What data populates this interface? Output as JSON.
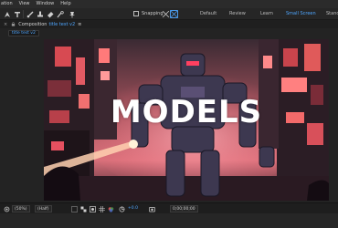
{
  "menu": [
    "ation",
    "View",
    "Window",
    "Help"
  ],
  "toolbar": {
    "tools": [
      "pen-tool-icon",
      "type-tool-icon",
      "brush-tool-icon",
      "clone-stamp-icon",
      "eraser-icon",
      "roto-brush-icon",
      "puppet-pin-icon"
    ],
    "snapping_label": "Snapping",
    "workspaces": [
      "Default",
      "Review",
      "Learn",
      "Small Screen",
      "Stand"
    ],
    "active_workspace": "Small Screen"
  },
  "panel": {
    "close": "×",
    "label": "Composition",
    "comp_name": "title test v2",
    "menu": "≡",
    "tab_label": "title test v2"
  },
  "viewer": {
    "title_text": "MODELS"
  },
  "bottom": {
    "zoom": "(50%)",
    "resolution": "(Half)",
    "exposure": "+0.0",
    "timecode": "0;00;00;00"
  },
  "colors": {
    "accent": "#4ea6ff",
    "bg": "#232323"
  }
}
